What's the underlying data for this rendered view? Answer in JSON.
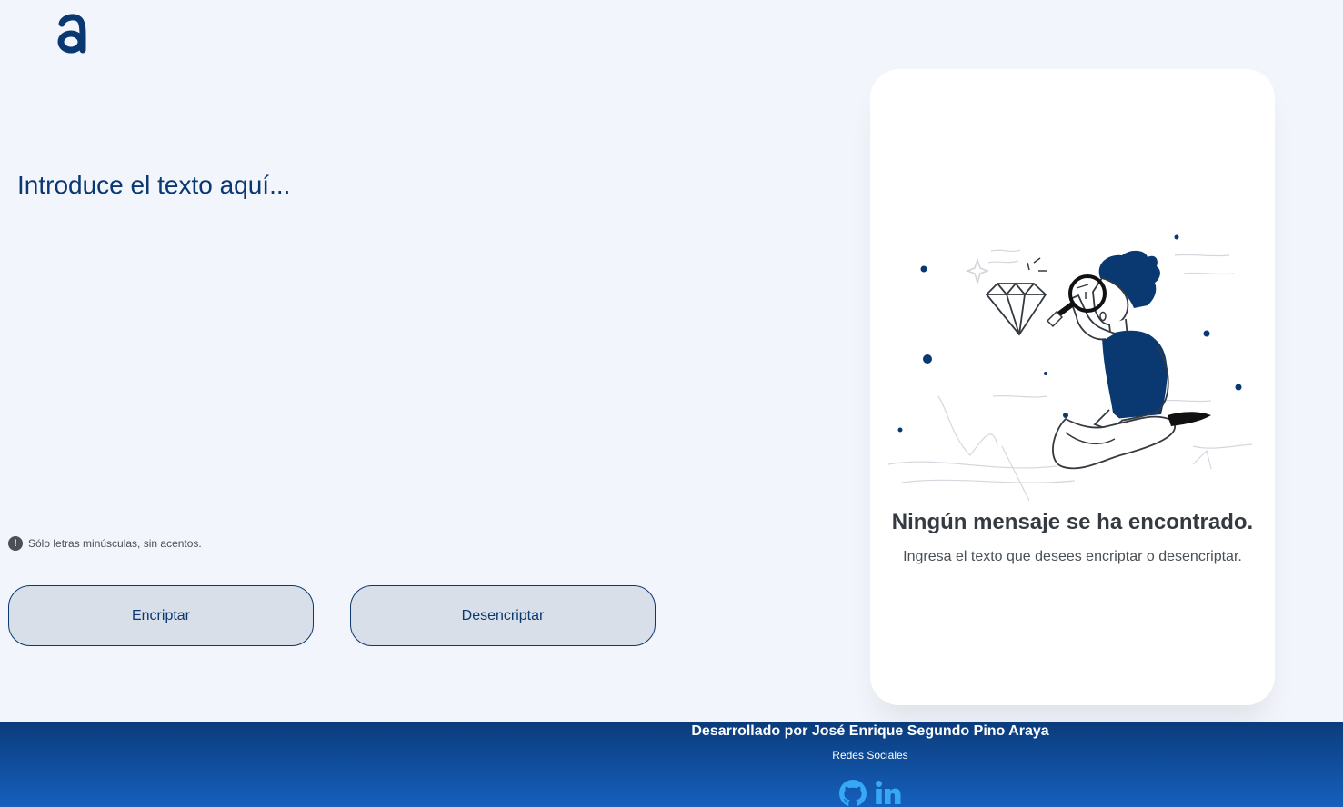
{
  "logo": {
    "icon": "alura-logo",
    "color": "#0A3871"
  },
  "input": {
    "placeholder": "Introduce el texto aquí..."
  },
  "hint": {
    "icon": "exclamation-circle-icon",
    "text": "Sólo letras minúsculas, sin acentos."
  },
  "buttons": {
    "encrypt_label": "Encriptar",
    "decrypt_label": "Desencriptar"
  },
  "result": {
    "illustration": "person-with-magnifying-glass",
    "title": "Ningún mensaje se ha encontrado.",
    "subtitle": "Ingresa el texto que desees encriptar o desencriptar."
  },
  "footer": {
    "developer": "Desarrollado por José Enrique Segundo Pino Araya",
    "social_label": "Redes Sociales",
    "links": [
      {
        "icon": "github-icon"
      },
      {
        "icon": "linkedin-icon"
      }
    ]
  },
  "colors": {
    "primary": "#0A3871",
    "background": "#F3F5FC",
    "button": "#D8DFE8",
    "footer_icon": "#36A8F5"
  }
}
